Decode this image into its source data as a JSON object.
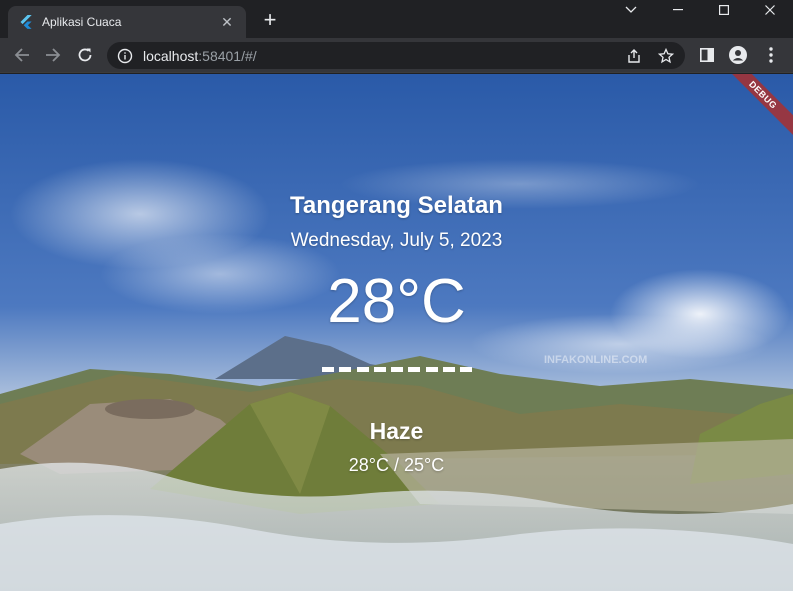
{
  "browser": {
    "tab": {
      "title": "Aplikasi Cuaca",
      "favicon": "flutter-icon"
    },
    "new_tab_label": "+",
    "address": {
      "host": "localhost",
      "rest": ":58401/#/"
    },
    "icons": [
      "back-arrow-icon",
      "forward-arrow-icon",
      "reload-icon",
      "info-icon",
      "share-icon",
      "star-icon",
      "side-panel-icon",
      "profile-icon",
      "kebab-menu-icon"
    ]
  },
  "app": {
    "debug_banner": "DEBUG",
    "city": "Tangerang Selatan",
    "date": "Wednesday, July 5, 2023",
    "temperature": "28°C",
    "condition": "Haze",
    "range": "28°C / 25°C",
    "watermark": "INFAKONLINE.COM"
  },
  "colors": {
    "chrome_dark": "#202124",
    "chrome_tab": "#35363a",
    "sky_top": "#2f5fae",
    "debug_red": "#a83030"
  }
}
